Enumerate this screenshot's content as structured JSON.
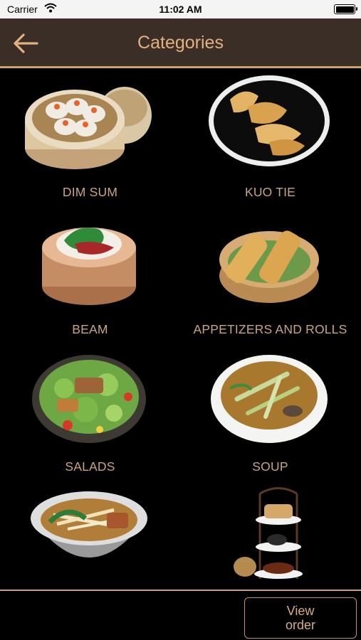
{
  "status_bar": {
    "carrier": "Carrier",
    "time": "11:02 AM",
    "icons": [
      "wifi-icon",
      "battery-icon"
    ]
  },
  "header": {
    "title": "Categories",
    "back_icon": "arrow-left-icon"
  },
  "categories": [
    {
      "label": "DIM SUM",
      "image": "steamer-dumplings"
    },
    {
      "label": "KUO TIE",
      "image": "potstickers-plate"
    },
    {
      "label": "BEAM",
      "image": "bao-steamer"
    },
    {
      "label": "APPETIZERS AND ROLLS",
      "image": "spring-rolls-basket"
    },
    {
      "label": "SALADS",
      "image": "salad-plate"
    },
    {
      "label": "SOUP",
      "image": "soup-bowl"
    },
    {
      "label": "",
      "image": "noodle-soup-bowl"
    },
    {
      "label": "",
      "image": "tea-stand"
    }
  ],
  "footer": {
    "view_order_label": "View\norder"
  },
  "colors": {
    "nav_background": "#3b2e26",
    "accent": "#d2a070",
    "title_text": "#e3b180",
    "label_text": "#caa482"
  }
}
